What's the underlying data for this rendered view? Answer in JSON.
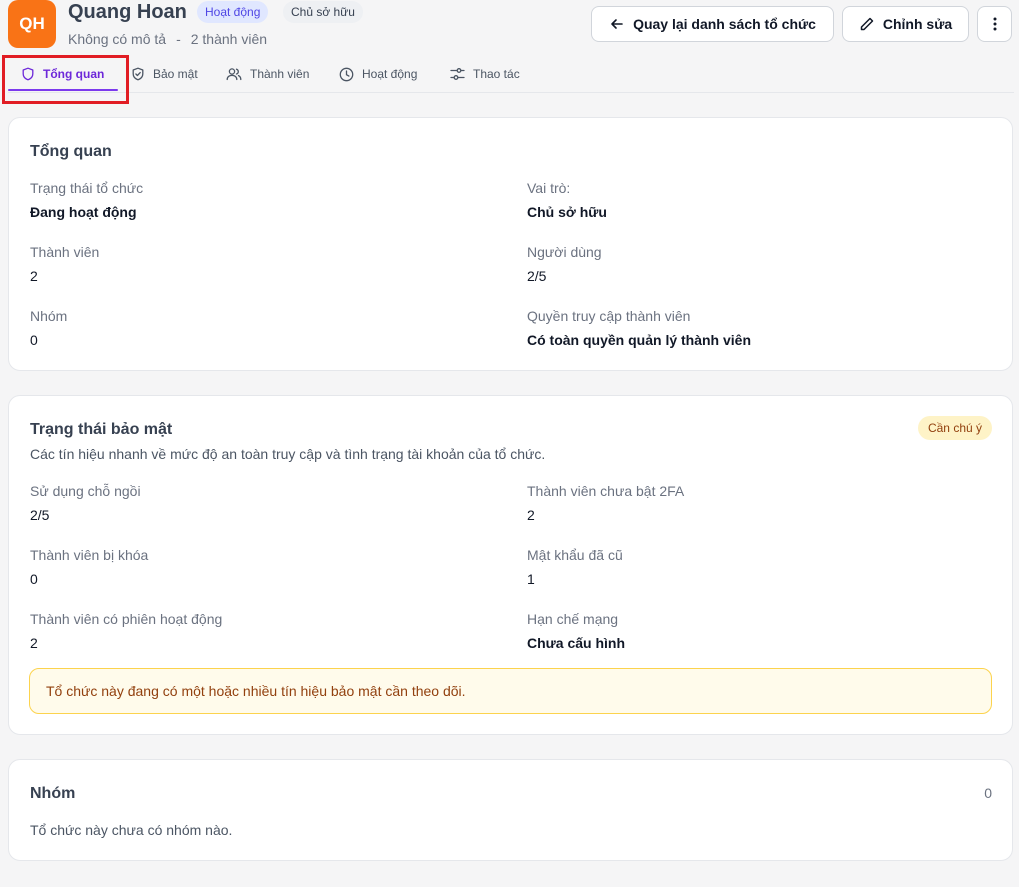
{
  "header": {
    "avatar_initials": "QH",
    "org_name": "Quang Hoan",
    "status_badge": "Hoạt động",
    "role_badge": "Chủ sở hữu",
    "description": "Không có mô tả",
    "separator": "-",
    "member_count_text": "2 thành viên",
    "back_button": "Quay lại danh sách tổ chức",
    "edit_button": "Chỉnh sửa",
    "more_icon": "more-vertical-icon"
  },
  "tabs": [
    {
      "label": "Tổng quan",
      "icon": "shield-icon",
      "active": true
    },
    {
      "label": "Bảo mật",
      "icon": "shield-check-icon",
      "active": false
    },
    {
      "label": "Thành viên",
      "icon": "users-icon",
      "active": false
    },
    {
      "label": "Hoạt động",
      "icon": "clock-icon",
      "active": false
    },
    {
      "label": "Thao tác",
      "icon": "sliders-icon",
      "active": false
    }
  ],
  "overview": {
    "title": "Tổng quan",
    "fields": [
      {
        "label": "Trạng thái tổ chức",
        "value": "Đang hoạt động"
      },
      {
        "label": "Vai trò:",
        "value": "Chủ sở hữu"
      },
      {
        "label": "Thành viên",
        "value": "2"
      },
      {
        "label": "Người dùng",
        "value": "2/5"
      },
      {
        "label": "Nhóm",
        "value": "0"
      },
      {
        "label": "Quyền truy cập thành viên",
        "value": "Có toàn quyền quản lý thành viên"
      }
    ]
  },
  "security": {
    "title": "Trạng thái bảo mật",
    "badge": "Cần chú ý",
    "description": "Các tín hiệu nhanh về mức độ an toàn truy cập và tình trạng tài khoản của tổ chức.",
    "fields": [
      {
        "label": "Sử dụng chỗ ngồi",
        "value": "2/5"
      },
      {
        "label": "Thành viên chưa bật 2FA",
        "value": "2"
      },
      {
        "label": "Thành viên bị khóa",
        "value": "0"
      },
      {
        "label": "Mật khẩu đã cũ",
        "value": "1"
      },
      {
        "label": "Thành viên có phiên hoạt động",
        "value": "2"
      },
      {
        "label": "Hạn chế mạng",
        "value": "Chưa cấu hình"
      }
    ],
    "alert": "Tổ chức này đang có một hoặc nhiều tín hiệu bảo mật cần theo dõi."
  },
  "groups": {
    "title": "Nhóm",
    "count": "0",
    "empty_text": "Tổ chức này chưa có nhóm nào."
  },
  "colors": {
    "accent": "#7c3aed",
    "avatar": "#f97316",
    "highlight": "#e11d24",
    "warning_bg": "#fffbeb"
  }
}
